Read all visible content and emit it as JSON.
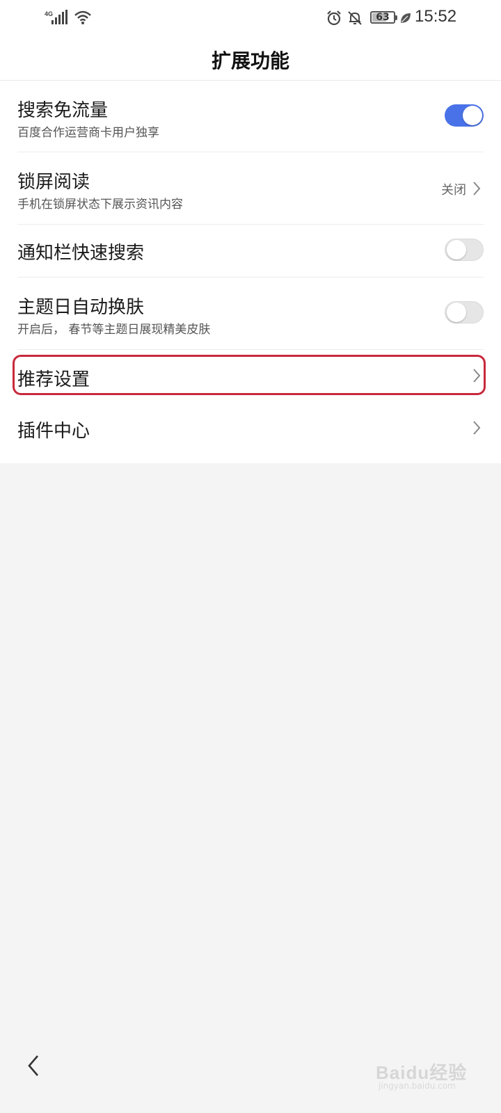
{
  "status_bar": {
    "network": "4G",
    "battery": "63",
    "time": "15:52",
    "icons": [
      "signal-icon",
      "wifi-icon",
      "alarm-icon",
      "bell-off-icon",
      "battery-icon",
      "leaf-icon"
    ]
  },
  "header": {
    "title": "扩展功能"
  },
  "settings": {
    "search_free": {
      "title": "搜索免流量",
      "subtitle": "百度合作运营商卡用户独享",
      "toggle": "on"
    },
    "lock_screen": {
      "title": "锁屏阅读",
      "subtitle": "手机在锁屏状态下展示资讯内容",
      "value": "关闭"
    },
    "notification_search": {
      "title": "通知栏快速搜索",
      "toggle": "off"
    },
    "theme_day": {
      "title": "主题日自动换肤",
      "subtitle": "开启后， 春节等主题日展现精美皮肤",
      "toggle": "off"
    },
    "recommend": {
      "title": "推荐设置"
    },
    "plugin": {
      "title": "插件中心"
    }
  },
  "colors": {
    "toggle_on": "#4a72e8",
    "highlight": "#c8283c",
    "background": "#f4f4f4"
  },
  "watermark": {
    "brand": "Baidu经验",
    "url": "jingyan.baidu.com"
  }
}
